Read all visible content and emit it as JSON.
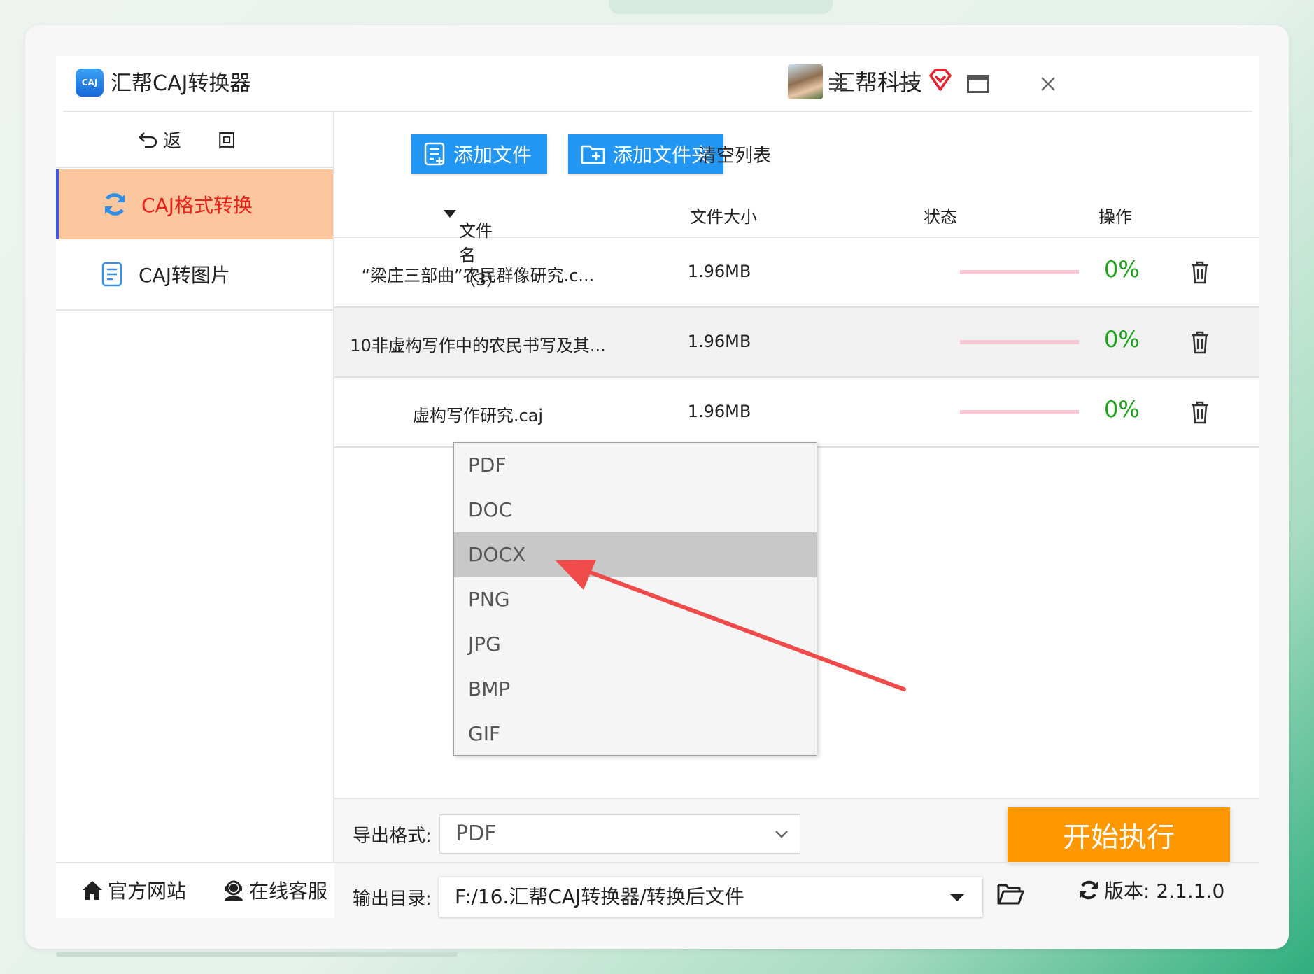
{
  "app": {
    "logo_text": "CAJ",
    "title": "汇帮CAJ转换器"
  },
  "user": {
    "name": "汇帮科技"
  },
  "sidebar": {
    "back_label": "返 回",
    "items": [
      {
        "label": "CAJ格式转换",
        "active": true
      },
      {
        "label": "CAJ转图片",
        "active": false
      }
    ]
  },
  "toolbar": {
    "add_file": "添加文件",
    "add_folder": "添加文件夹",
    "clear_list": "清空列表"
  },
  "table": {
    "headers": {
      "name": "文件名（3）",
      "size": "文件大小",
      "status": "状态",
      "action": "操作"
    },
    "rows": [
      {
        "name": "“梁庄三部曲”农民群像研究.c...",
        "size": "1.96MB",
        "progress": 0,
        "percent": "0%"
      },
      {
        "name": "10非虚构写作中的农民书写及其...",
        "size": "1.96MB",
        "progress": 0,
        "percent": "0%"
      },
      {
        "name": "虚构写作研究.caj",
        "size": "1.96MB",
        "progress": 0,
        "percent": "0%"
      }
    ]
  },
  "format_dropdown": {
    "options": [
      "PDF",
      "DOC",
      "DOCX",
      "PNG",
      "JPG",
      "BMP",
      "GIF"
    ],
    "highlighted": "DOCX"
  },
  "export": {
    "label": "导出格式:",
    "selected": "PDF"
  },
  "output": {
    "label": "输出目录:",
    "path": "F:/16.汇帮CAJ转换器/转换后文件"
  },
  "start_button": "开始执行",
  "footer": {
    "website": "官方网站",
    "support": "在线客服",
    "version": "版本: 2.1.1.0"
  },
  "colors": {
    "accent_blue": "#2196f3",
    "start_orange": "#ff9800",
    "active_bg": "#fcc69e",
    "active_text": "#e8211a",
    "percent_green": "#1aa31a",
    "arrow_red": "#f04b4b"
  }
}
